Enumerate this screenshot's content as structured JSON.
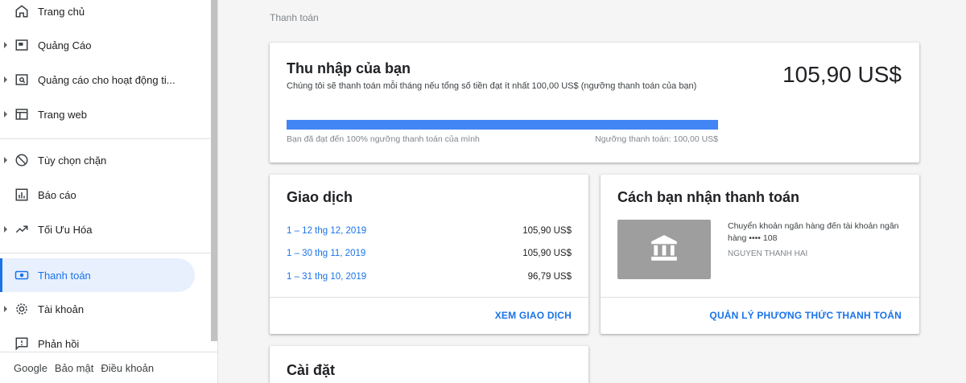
{
  "sidebar": {
    "items": [
      {
        "label": "Trang chủ",
        "icon": "home-icon"
      },
      {
        "label": "Quảng Cáo",
        "icon": "ads-icon"
      },
      {
        "label": "Quảng cáo cho hoạt động ti...",
        "icon": "search-ads-icon"
      },
      {
        "label": "Trang web",
        "icon": "website-icon"
      },
      {
        "label": "Tùy chọn chặn",
        "icon": "block-icon"
      },
      {
        "label": "Báo cáo",
        "icon": "reports-icon"
      },
      {
        "label": "Tối Ưu Hóa",
        "icon": "trending-icon"
      },
      {
        "label": "Thanh toán",
        "icon": "payments-icon"
      },
      {
        "label": "Tài khoản",
        "icon": "gear-icon"
      },
      {
        "label": "Phản hồi",
        "icon": "feedback-icon"
      }
    ],
    "footer": {
      "google": "Google",
      "privacy": "Bảo mật",
      "terms": "Điều khoản"
    }
  },
  "breadcrumb": "Thanh toán",
  "earnings": {
    "title": "Thu nhập của bạn",
    "amount": "105,90 US$",
    "subtitle": "Chúng tôi sẽ thanh toán mỗi tháng nếu tổng số tiền đạt ít nhất 100,00 US$ (ngưỡng thanh toán của bạn)",
    "progress_percent": 100,
    "progress_left": "Bạn đã đạt đến 100% ngưỡng thanh toán của mình",
    "progress_right": "Ngưỡng thanh toán: 100,00 US$"
  },
  "transactions": {
    "title": "Giao dịch",
    "rows": [
      {
        "date": "1 – 12 thg 12, 2019",
        "amount": "105,90 US$"
      },
      {
        "date": "1 – 30 thg 11, 2019",
        "amount": "105,90 US$"
      },
      {
        "date": "1 – 31 thg 10, 2019",
        "amount": "96,79 US$"
      }
    ],
    "link": "XEM GIAO DỊCH"
  },
  "payment_method": {
    "title": "Cách bạn nhận thanh toán",
    "description": "Chuyển khoản ngân hàng đến tài khoản ngân hàng •••• 108",
    "holder": "NGUYEN THANH HAI",
    "link": "QUẢN LÝ PHƯƠNG THỨC THANH TOÁN"
  },
  "settings": {
    "title": "Cài đặt"
  },
  "colors": {
    "accent": "#1a73e8",
    "progress": "#4285f4"
  }
}
